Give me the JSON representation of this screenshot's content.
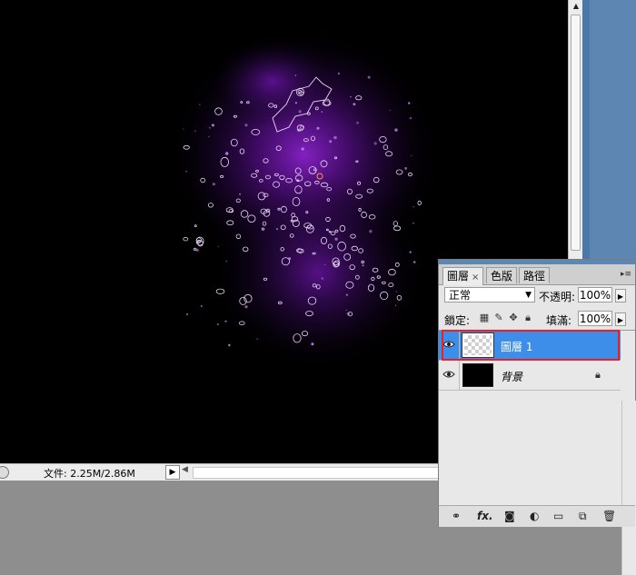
{
  "status_bar": {
    "doc_info": "文件: 2.25M/2.86M"
  },
  "layers_panel": {
    "tabs": [
      {
        "label": "圖層",
        "close": "×",
        "active": true
      },
      {
        "label": "色版",
        "active": false
      },
      {
        "label": "路徑",
        "active": false
      }
    ],
    "blend_mode": "正常",
    "opacity_label": "不透明:",
    "opacity_value": "100%",
    "lock_label": "鎖定:",
    "fill_label": "填滿:",
    "fill_value": "100%",
    "layers": [
      {
        "name": "圖層 1",
        "visible": true,
        "selected": true,
        "thumbnail": "transparent"
      },
      {
        "name": "背景",
        "visible": true,
        "selected": false,
        "thumbnail": "black",
        "locked": true
      }
    ],
    "bottom_icons": [
      "link-icon",
      "fx-icon",
      "mask-icon",
      "adjustment-icon",
      "group-folder-icon",
      "new-layer-icon",
      "trash-icon"
    ],
    "fx_label": "fx."
  },
  "colors": {
    "selected_layer": "#3d8ee8",
    "highlight_border": "#e8202a",
    "nebula_purple": "#7a16b8"
  }
}
